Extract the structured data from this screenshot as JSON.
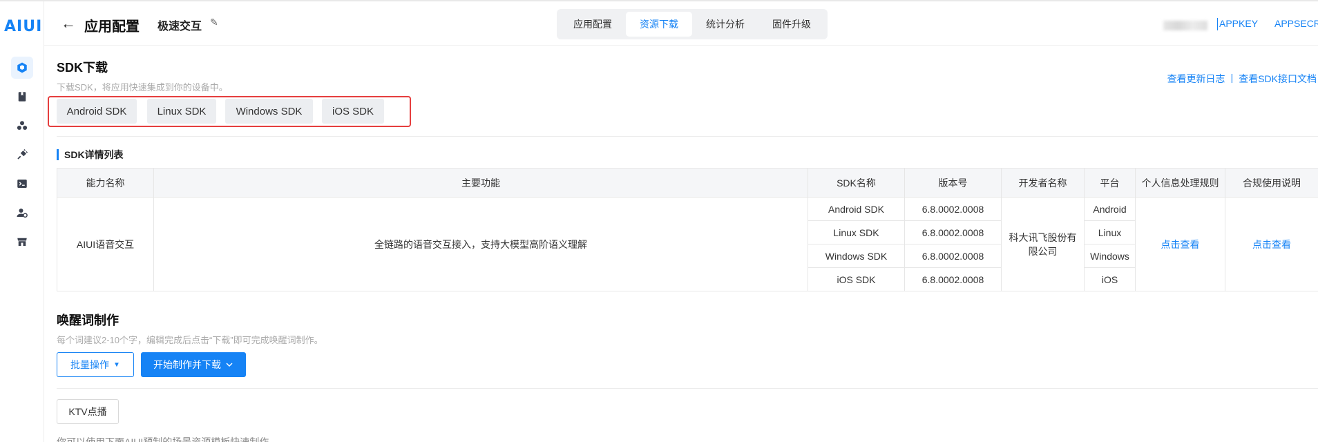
{
  "brand": {
    "logo_text": "AIUI",
    "accent": "#1683f5"
  },
  "sidebar": {
    "items": [
      {
        "icon": "cube-icon",
        "active": true
      },
      {
        "icon": "book-icon",
        "active": false
      },
      {
        "icon": "cluster-icon",
        "active": false
      },
      {
        "icon": "plug-icon",
        "active": false
      },
      {
        "icon": "terminal-icon",
        "active": false
      },
      {
        "icon": "user-settings-icon",
        "active": false
      },
      {
        "icon": "store-icon",
        "active": false
      }
    ]
  },
  "header": {
    "back_icon": "←",
    "title": "应用配置",
    "app_name": "极速交互",
    "edit_icon": "✎",
    "tabs": [
      {
        "label": "应用配置",
        "active": false
      },
      {
        "label": "资源下载",
        "active": true
      },
      {
        "label": "统计分析",
        "active": false
      },
      {
        "label": "固件升级",
        "active": false
      }
    ],
    "appkey_label": "APPKEY",
    "appsecret_label": "APPSECRET"
  },
  "sdk_download": {
    "title": "SDK下载",
    "desc": "下载SDK，将应用快速集成到你的设备中。",
    "links": {
      "changelog": "查看更新日志",
      "separator": "|",
      "docs": "查看SDK接口文档"
    },
    "buttons": [
      "Android SDK",
      "Linux SDK",
      "Windows SDK",
      "iOS SDK"
    ]
  },
  "sdk_list": {
    "title": "SDK详情列表",
    "headers": [
      "能力名称",
      "主要功能",
      "SDK名称",
      "版本号",
      "开发者名称",
      "平台",
      "个人信息处理规则",
      "合规使用说明"
    ],
    "capability": "AIUI语音交互",
    "feature": "全链路的语音交互接入，支持大模型高阶语义理解",
    "developer": "科大讯飞股份有限公司",
    "privacy_link": "点击查看",
    "compliance_link": "点击查看",
    "rows": [
      {
        "sdk": "Android SDK",
        "version": "6.8.0002.0008",
        "platform": "Android"
      },
      {
        "sdk": "Linux SDK",
        "version": "6.8.0002.0008",
        "platform": "Linux"
      },
      {
        "sdk": "Windows SDK",
        "version": "6.8.0002.0008",
        "platform": "Windows"
      },
      {
        "sdk": "iOS SDK",
        "version": "6.8.0002.0008",
        "platform": "iOS"
      }
    ]
  },
  "wakeword": {
    "title": "唤醒词制作",
    "desc": "每个词建议2-10个字，编辑完成后点击“下载”即可完成唤醒词制作。",
    "batch_label": "批量操作",
    "start_label": "开始制作并下载",
    "ktv_label": "KTV点播",
    "tail_text": "你可以使用下面AIUI预制的场景资源模板快速制作"
  }
}
